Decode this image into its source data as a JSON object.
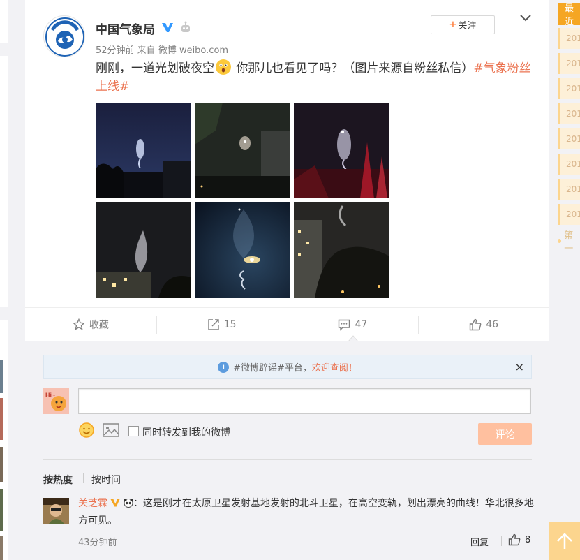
{
  "post": {
    "author": "中国气象局",
    "meta": "52分钟前 来自 微博 weibo.com",
    "follow_label": "关注",
    "follow_plus": "+",
    "text_before": "刚刚，一道光划破夜空",
    "text_after": " 你那儿也看见了吗？（图片来源自粉丝私信）",
    "hashtag": "#气象粉丝上线#",
    "photo_count": 6
  },
  "actions": {
    "favorite": "收藏",
    "repost": "15",
    "comment": "47",
    "like": "46"
  },
  "comment_box": {
    "notice_prefix": "#微博辟谣#平台，",
    "notice_link": "欢迎查阅！",
    "notice_close": "×",
    "checkbox_label": "同时转发到我的微博",
    "submit_label": "评论",
    "input_value": ""
  },
  "sort": {
    "hot": "按热度",
    "time": "按时间"
  },
  "comments": [
    {
      "user": "关芝霖",
      "separator": "：",
      "text": "这是刚才在太原卫星发射基地发射的北斗卫星，在高空变轨，划出漂亮的曲线！华北很多地方可见。",
      "time": "43分钟前",
      "reply_label": "回复",
      "likes": "8"
    }
  ],
  "sidebar": {
    "recent": "最近",
    "years": [
      "201",
      "201",
      "201",
      "201",
      "201",
      "201",
      "201",
      "201"
    ],
    "more": "第一"
  },
  "colors": {
    "accent": "#eb7350",
    "sidebar_orange": "#f5a623",
    "submit_disabled": "#ffc09f"
  }
}
